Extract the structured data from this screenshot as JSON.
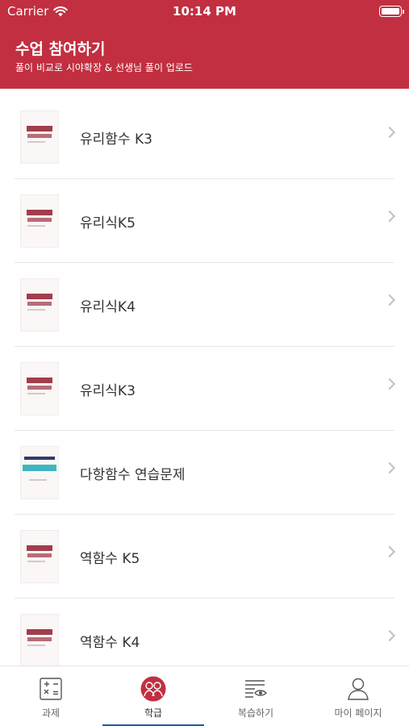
{
  "status_bar": {
    "carrier": "Carrier",
    "time": "10:14 PM"
  },
  "header": {
    "title": "수업 참여하기",
    "subtitle": "풀이 비교로 시야확장 & 선생님 풀이 업로드"
  },
  "items": [
    {
      "label": "유리함수 K3"
    },
    {
      "label": "유리식K5"
    },
    {
      "label": "유리식K4"
    },
    {
      "label": "유리식K3"
    },
    {
      "label": "다항함수 연습문제"
    },
    {
      "label": "역함수 K5"
    },
    {
      "label": "역함수 K4"
    }
  ],
  "tabs": [
    {
      "label": "과제",
      "icon": "calculator-icon"
    },
    {
      "label": "학급",
      "icon": "class-icon",
      "active": true
    },
    {
      "label": "복습하기",
      "icon": "review-icon"
    },
    {
      "label": "마이 페이지",
      "icon": "profile-icon"
    }
  ],
  "colors": {
    "brand": "#c22f40",
    "active_underline": "#2358a8"
  }
}
